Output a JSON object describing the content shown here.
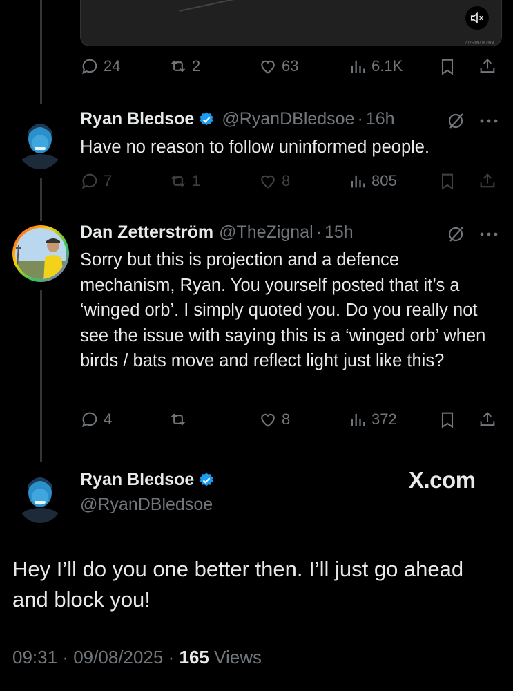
{
  "icons": {
    "reply": "reply-bubble-icon",
    "repost": "repost-arrows-icon",
    "like": "heart-icon",
    "views": "analytics-bars-icon",
    "bookmark": "bookmark-icon",
    "share": "share-upload-icon",
    "verified": "verified-badge-icon",
    "grok": "grok-icon",
    "more": "more-dots-icon",
    "mute": "speaker-muted-icon"
  },
  "colors": {
    "verified": "#1d9bf0",
    "muted_text": "#71767b",
    "background": "#000000"
  },
  "video": {
    "timestamp": "2025/09/08 09:4"
  },
  "top_post": {
    "replies": "24",
    "reposts": "2",
    "likes": "63",
    "views": "6.1K"
  },
  "post1": {
    "name": "Ryan Bledsoe",
    "handle": "@RyanDBledsoe",
    "time": "16h",
    "text": "Have no reason to follow uninformed people.",
    "replies": "7",
    "reposts": "1",
    "likes": "8",
    "views": "805"
  },
  "post2": {
    "name": "Dan Zetterström",
    "handle": "@TheZignal",
    "time": "15h",
    "text": "Sorry but this is projection and a defence mechanism, Ryan. You yourself posted that it’s a ‘winged orb’. I simply quoted you. Do you really not see the issue with saying this is a ‘winged orb’ when birds / bats move and reflect light just like this?",
    "replies": "4",
    "reposts": "",
    "likes": "8",
    "views": "372"
  },
  "main_post": {
    "name": "Ryan Bledsoe",
    "handle": "@RyanDBledsoe",
    "watermark": "X.com",
    "text": "Hey I’ll do you one better then. I’ll just go ahead and block you!",
    "time": "09:31",
    "date": "09/08/2025",
    "views_count": "165",
    "views_label": "Views",
    "separator": "·"
  }
}
